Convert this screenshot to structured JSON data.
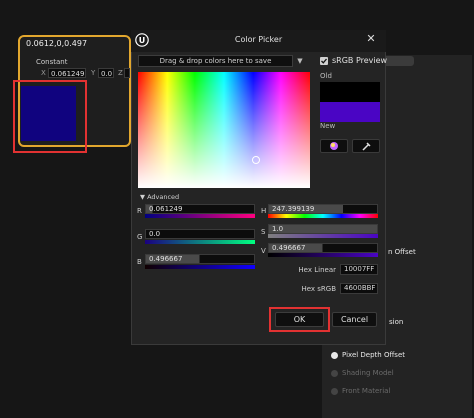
{
  "node": {
    "header": "0.0612,0,0.497",
    "subtitle": "Constant",
    "x_label": "X",
    "x_value": "0.061249",
    "y_label": "Y",
    "y_value": "0.0",
    "z_label": "Z",
    "swatch_color": "#10037f"
  },
  "dialog": {
    "title": "Color Picker",
    "dropzone": "Drag & drop colors here to save",
    "srgb_preview": "sRGB Preview",
    "old_label": "Old",
    "new_label": "New",
    "old_color": "#000000",
    "new_color": "#4a05c4",
    "advanced": "Advanced",
    "sliders": {
      "r": {
        "label": "R",
        "value": "0.061249",
        "fraction": 0.061249
      },
      "g": {
        "label": "G",
        "value": "0.0",
        "fraction": 0.0
      },
      "b": {
        "label": "B",
        "value": "0.496667",
        "fraction": 0.496667
      },
      "h": {
        "label": "H",
        "value": "247.399139",
        "fraction": 0.687
      },
      "s": {
        "label": "S",
        "value": "1.0",
        "fraction": 1.0
      },
      "v": {
        "label": "V",
        "value": "0.496667",
        "fraction": 0.496667
      }
    },
    "hex_linear_label": "Hex Linear",
    "hex_linear_value": "10007FF",
    "hex_srgb_label": "Hex sRGB",
    "hex_srgb_value": "4600BBF",
    "ok_label": "OK",
    "cancel_label": "Cancel",
    "highlight_color": "#e23232"
  },
  "right_panel": {
    "item_offset": "n Offset",
    "item_sion": "sion",
    "pixel_depth": "Pixel Depth Offset",
    "shading_model": "Shading Model",
    "front_material": "Front Material"
  }
}
